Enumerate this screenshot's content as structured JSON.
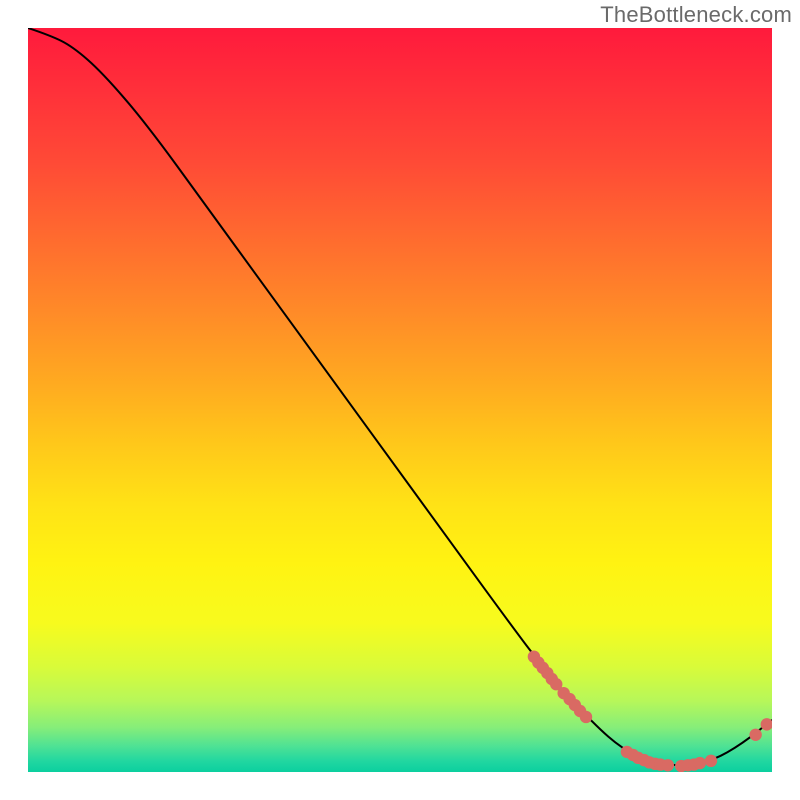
{
  "watermark": "TheBottleneck.com",
  "chart_data": {
    "type": "line",
    "title": "",
    "xlabel": "",
    "ylabel": "",
    "xlim": [
      0,
      100
    ],
    "ylim": [
      0,
      100
    ],
    "grid": false,
    "legend": false,
    "curve": {
      "name": "bottleneck-curve",
      "color": "#000000",
      "points": [
        {
          "x": 0.0,
          "y": 100.0
        },
        {
          "x": 3.0,
          "y": 99.0
        },
        {
          "x": 6.0,
          "y": 97.5
        },
        {
          "x": 10.0,
          "y": 94.0
        },
        {
          "x": 16.0,
          "y": 87.0
        },
        {
          "x": 24.0,
          "y": 76.0
        },
        {
          "x": 32.0,
          "y": 65.0
        },
        {
          "x": 40.0,
          "y": 54.0
        },
        {
          "x": 48.0,
          "y": 43.0
        },
        {
          "x": 56.0,
          "y": 32.0
        },
        {
          "x": 64.0,
          "y": 21.0
        },
        {
          "x": 70.0,
          "y": 13.0
        },
        {
          "x": 76.0,
          "y": 6.5
        },
        {
          "x": 80.0,
          "y": 3.0
        },
        {
          "x": 84.0,
          "y": 1.2
        },
        {
          "x": 88.0,
          "y": 0.8
        },
        {
          "x": 92.0,
          "y": 1.5
        },
        {
          "x": 96.0,
          "y": 3.8
        },
        {
          "x": 100.0,
          "y": 7.0
        }
      ]
    },
    "marker_clusters": [
      {
        "name": "cluster-descent",
        "color": "#d96a63",
        "points": [
          {
            "x": 68.0,
            "y": 15.5
          },
          {
            "x": 68.6,
            "y": 14.7
          },
          {
            "x": 69.2,
            "y": 14.0
          },
          {
            "x": 69.8,
            "y": 13.3
          },
          {
            "x": 70.4,
            "y": 12.5
          },
          {
            "x": 71.0,
            "y": 11.8
          },
          {
            "x": 72.0,
            "y": 10.6
          },
          {
            "x": 72.8,
            "y": 9.8
          },
          {
            "x": 73.5,
            "y": 9.0
          },
          {
            "x": 74.2,
            "y": 8.2
          },
          {
            "x": 75.0,
            "y": 7.4
          }
        ]
      },
      {
        "name": "cluster-valley",
        "color": "#d96a63",
        "points": [
          {
            "x": 80.5,
            "y": 2.7
          },
          {
            "x": 81.3,
            "y": 2.3
          },
          {
            "x": 82.0,
            "y": 1.9
          },
          {
            "x": 82.8,
            "y": 1.6
          },
          {
            "x": 83.5,
            "y": 1.3
          },
          {
            "x": 84.3,
            "y": 1.1
          },
          {
            "x": 85.0,
            "y": 1.0
          },
          {
            "x": 86.0,
            "y": 0.9
          },
          {
            "x": 87.8,
            "y": 0.8
          },
          {
            "x": 88.7,
            "y": 0.9
          },
          {
            "x": 89.5,
            "y": 1.0
          },
          {
            "x": 90.3,
            "y": 1.2
          },
          {
            "x": 91.8,
            "y": 1.5
          }
        ]
      },
      {
        "name": "cluster-rise",
        "color": "#d96a63",
        "points": [
          {
            "x": 97.8,
            "y": 5.0
          },
          {
            "x": 99.3,
            "y": 6.4
          }
        ]
      }
    ]
  },
  "gradient": {
    "stops": [
      {
        "offset": 0.0,
        "color": "#ff1a3c"
      },
      {
        "offset": 0.08,
        "color": "#ff2f3a"
      },
      {
        "offset": 0.18,
        "color": "#ff4a36"
      },
      {
        "offset": 0.28,
        "color": "#ff6a2f"
      },
      {
        "offset": 0.38,
        "color": "#ff8a28"
      },
      {
        "offset": 0.48,
        "color": "#ffab20"
      },
      {
        "offset": 0.56,
        "color": "#ffc81a"
      },
      {
        "offset": 0.64,
        "color": "#ffe216"
      },
      {
        "offset": 0.72,
        "color": "#fff312"
      },
      {
        "offset": 0.8,
        "color": "#f7fb1e"
      },
      {
        "offset": 0.86,
        "color": "#d8fb3a"
      },
      {
        "offset": 0.905,
        "color": "#b6f75a"
      },
      {
        "offset": 0.94,
        "color": "#86ee79"
      },
      {
        "offset": 0.965,
        "color": "#4fe294"
      },
      {
        "offset": 0.985,
        "color": "#22d7a0"
      },
      {
        "offset": 1.0,
        "color": "#0bcf9f"
      }
    ]
  }
}
